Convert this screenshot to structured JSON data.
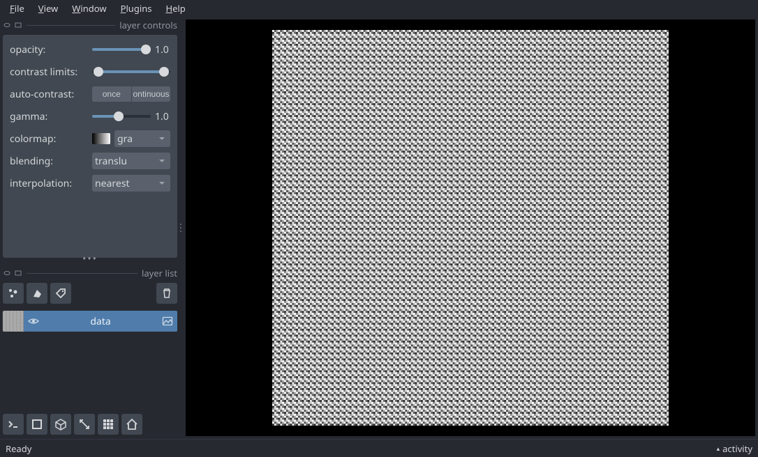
{
  "menubar": {
    "file": "File",
    "view": "View",
    "window": "Window",
    "plugins": "Plugins",
    "help": "Help"
  },
  "panels": {
    "layer_controls_title": "layer controls",
    "layer_list_title": "layer list"
  },
  "controls": {
    "opacity_label": "opacity:",
    "opacity_value": "1.0",
    "contrast_label": "contrast limits:",
    "autocontrast_label": "auto-contrast:",
    "autocontrast_once": "once",
    "autocontrast_continuous": "ontinuous",
    "gamma_label": "gamma:",
    "gamma_value": "1.0",
    "colormap_label": "colormap:",
    "colormap_value": "gra",
    "blending_label": "blending:",
    "blending_value": "translu",
    "interpolation_label": "interpolation:",
    "interpolation_value": "nearest"
  },
  "layers": [
    {
      "name": "data"
    }
  ],
  "status": {
    "left": "Ready",
    "activity": "activity"
  }
}
